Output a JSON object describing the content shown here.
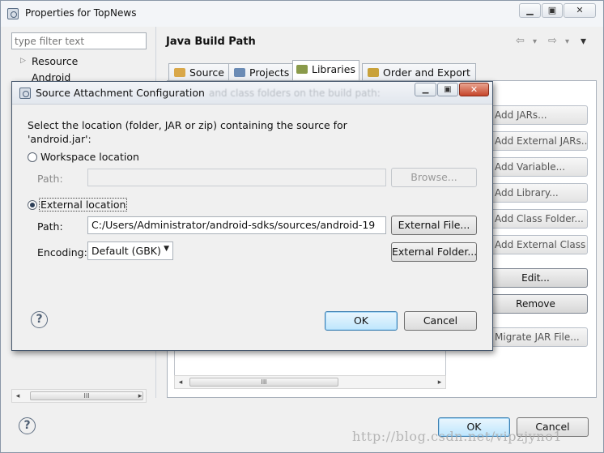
{
  "outer": {
    "title": "Properties for TopNews",
    "filter_placeholder": "type filter text",
    "tree_items": [
      "Resource",
      "Android"
    ],
    "hscroll_glyph": "III",
    "page_title": "Java Build Path",
    "nav_back": "⇦",
    "nav_fwd": "⇨",
    "nav_dd": "▾",
    "tabs": [
      {
        "label": "Source",
        "icon_color": "#d9a84a"
      },
      {
        "label": "Projects",
        "icon_color": "#6a8bb5"
      },
      {
        "label": "Libraries",
        "icon_color": "#8a9a4a"
      },
      {
        "label": "Order and Export",
        "icon_color": "#c9a23a"
      }
    ],
    "side_buttons": [
      {
        "label": "Add JARs...",
        "enabled": false
      },
      {
        "label": "Add External JARs...",
        "enabled": false
      },
      {
        "label": "Add Variable...",
        "enabled": false
      },
      {
        "label": "Add Library...",
        "enabled": false
      },
      {
        "label": "Add Class Folder...",
        "enabled": false
      },
      {
        "label": "Add External Class Folder...",
        "enabled": false
      },
      {
        "label": "Edit...",
        "enabled": true
      },
      {
        "label": "Remove",
        "enabled": true
      },
      {
        "label": "Migrate JAR File...",
        "enabled": false
      }
    ],
    "help_glyph": "?",
    "ok_label": "OK",
    "cancel_label": "Cancel",
    "watermark": "http://blog.csdn.net/vipzjyno1"
  },
  "dialog": {
    "title": "Source Attachment Configuration",
    "ghost_text": "and class folders on the build path:",
    "instruction_line1": "Select the location (folder, JAR or zip) containing the source for",
    "instruction_line2": "'android.jar':",
    "workspace_radio": {
      "label": "Workspace location",
      "selected": false
    },
    "workspace_path_label": "Path:",
    "workspace_path_value": "",
    "browse_label": "Browse...",
    "external_radio": {
      "label": "External location",
      "selected": true
    },
    "external_path_label": "Path:",
    "external_path_value": "C:/Users/Administrator/android-sdks/sources/android-19",
    "external_file_label": "External File...",
    "encoding_label": "Encoding:",
    "encoding_value": "Default (GBK)",
    "external_folder_label": "External Folder...",
    "help_glyph": "?",
    "ok_label": "OK",
    "cancel_label": "Cancel"
  }
}
